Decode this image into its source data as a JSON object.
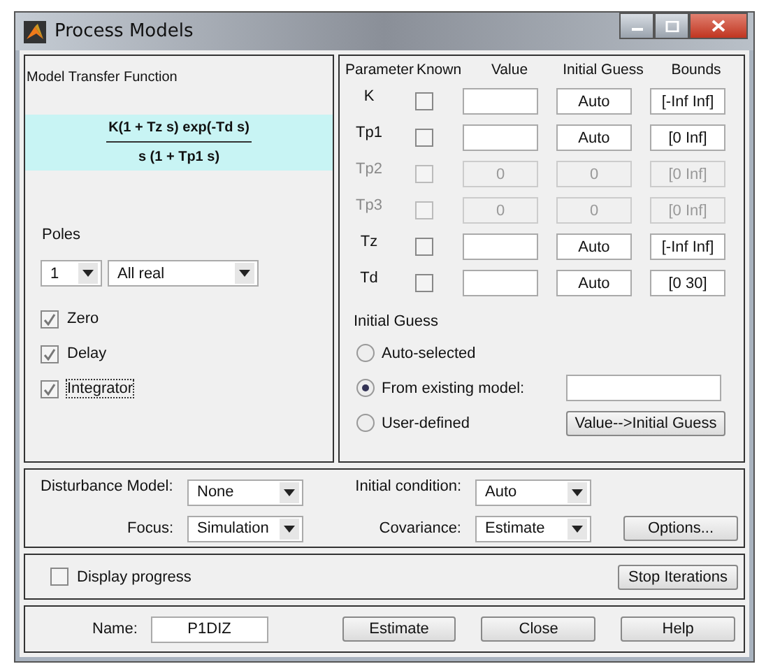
{
  "window": {
    "title": "Process Models"
  },
  "model": {
    "heading": "Model Transfer Function",
    "numerator": "K(1 + Tz s) exp(-Td s)",
    "denominator": "s (1 + Tp1 s)"
  },
  "poles": {
    "label": "Poles",
    "count": "1",
    "type": "All real"
  },
  "options": [
    {
      "label": "Zero",
      "checked": true,
      "focused": false
    },
    {
      "label": "Delay",
      "checked": true,
      "focused": false
    },
    {
      "label": "Integrator",
      "checked": true,
      "focused": true
    }
  ],
  "parameters": {
    "columns": [
      "Parameter",
      "Known",
      "Value",
      "Initial Guess",
      "Bounds"
    ],
    "rows": [
      {
        "name": "K",
        "known": false,
        "disabled": false,
        "value": "",
        "initial_guess": "Auto",
        "bounds": "[-Inf Inf]"
      },
      {
        "name": "Tp1",
        "known": false,
        "disabled": false,
        "value": "",
        "initial_guess": "Auto",
        "bounds": "[0 Inf]"
      },
      {
        "name": "Tp2",
        "known": false,
        "disabled": true,
        "value": "0",
        "initial_guess": "0",
        "bounds": "[0 Inf]"
      },
      {
        "name": "Tp3",
        "known": false,
        "disabled": true,
        "value": "0",
        "initial_guess": "0",
        "bounds": "[0 Inf]"
      },
      {
        "name": "Tz",
        "known": false,
        "disabled": false,
        "value": "",
        "initial_guess": "Auto",
        "bounds": "[-Inf Inf]"
      },
      {
        "name": "Td",
        "known": false,
        "disabled": false,
        "value": "",
        "initial_guess": "Auto",
        "bounds": "[0 30]"
      }
    ]
  },
  "initial_guess": {
    "label": "Initial Guess",
    "choices": [
      {
        "label": "Auto-selected",
        "selected": false
      },
      {
        "label": "From existing model:",
        "selected": true
      },
      {
        "label": "User-defined",
        "selected": false
      }
    ],
    "button": "Value-->Initial Guess"
  },
  "settings": {
    "disturbance_label": "Disturbance Model:",
    "disturbance": "None",
    "focus_label": "Focus:",
    "focus": "Simulation",
    "initial_condition_label": "Initial condition:",
    "initial_condition": "Auto",
    "covariance_label": "Covariance:",
    "covariance": "Estimate",
    "options_button": "Options..."
  },
  "progress": {
    "label": "Display progress",
    "checked": false,
    "stop_button": "Stop Iterations"
  },
  "footer": {
    "name_label": "Name:",
    "name": "P1DIZ",
    "buttons": [
      "Estimate",
      "Close",
      "Help"
    ]
  }
}
